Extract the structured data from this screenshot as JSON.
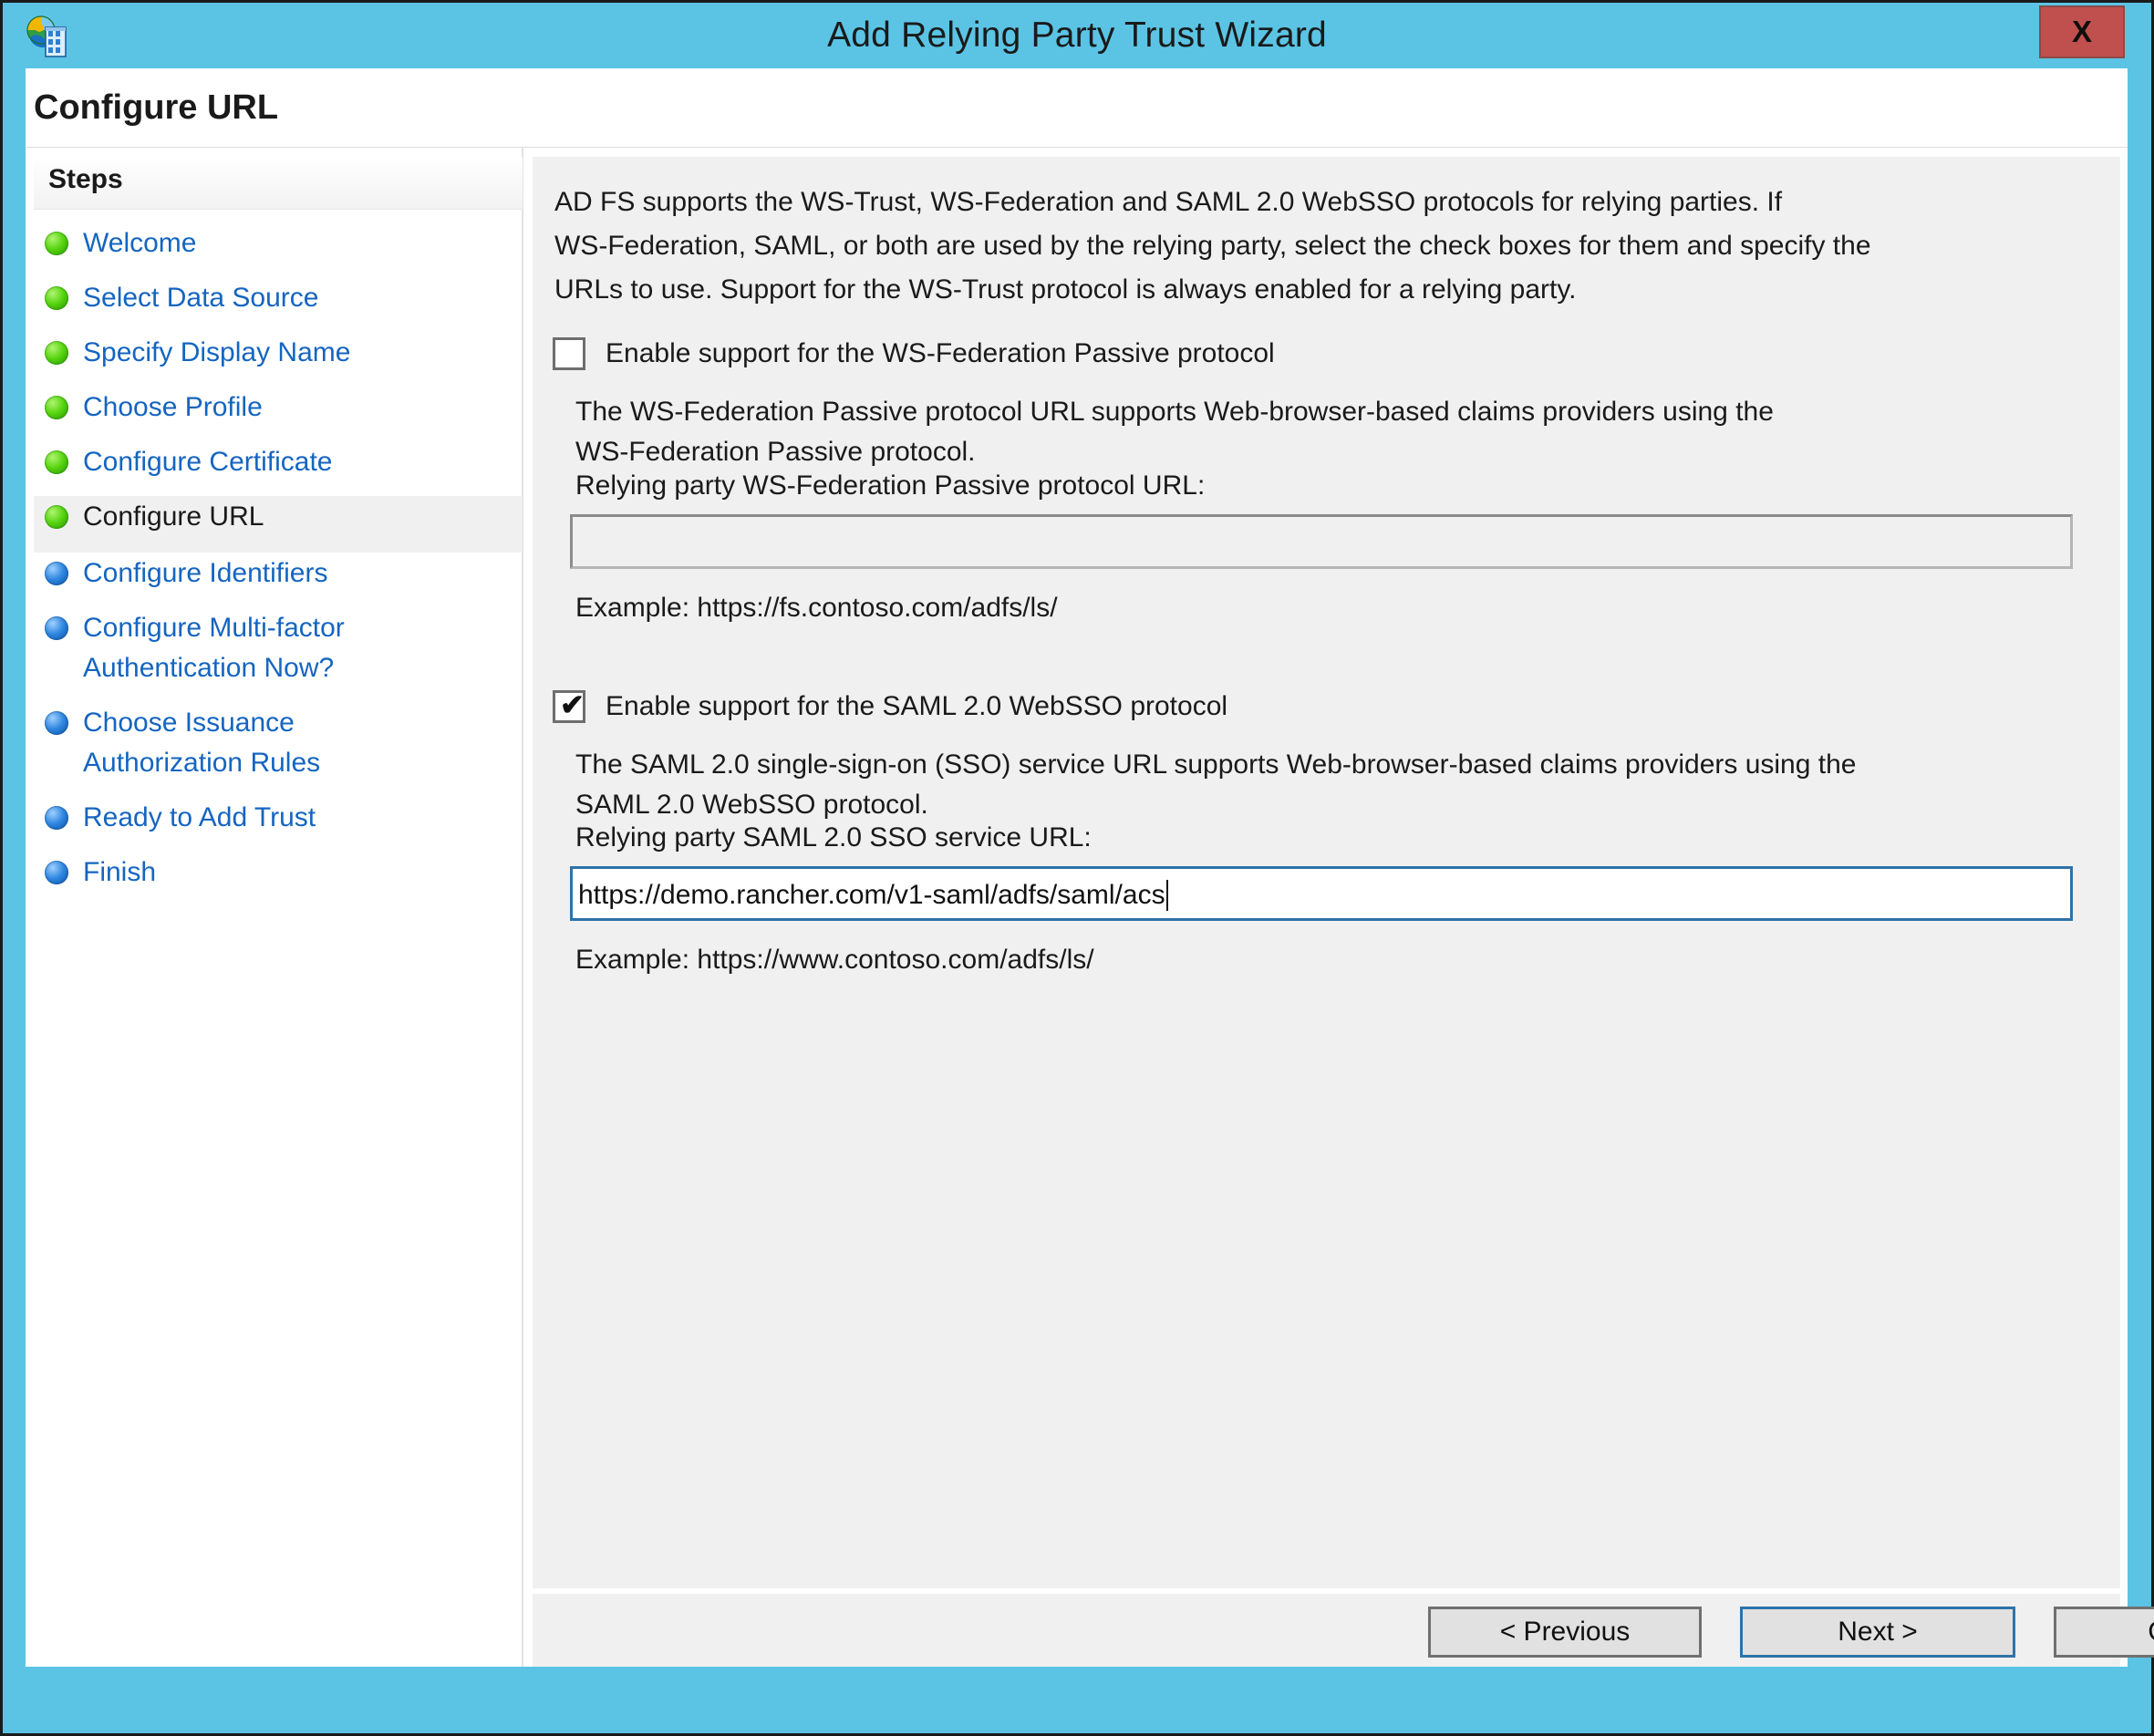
{
  "window": {
    "title": "Add Relying Party Trust Wizard",
    "close_label": "X",
    "icon": "relying-party-trust-icon",
    "titlebar_color": "#5BC4E4",
    "close_color": "#C0504D"
  },
  "page": {
    "heading": "Configure URL"
  },
  "sidebar": {
    "header": "Steps",
    "items": [
      {
        "label": "Welcome",
        "state": "done",
        "current": false
      },
      {
        "label": "Select Data Source",
        "state": "done",
        "current": false
      },
      {
        "label": "Specify Display Name",
        "state": "done",
        "current": false
      },
      {
        "label": "Choose Profile",
        "state": "done",
        "current": false
      },
      {
        "label": "Configure Certificate",
        "state": "done",
        "current": false
      },
      {
        "label": "Configure URL",
        "state": "done",
        "current": true
      },
      {
        "label": "Configure Identifiers",
        "state": "todo",
        "current": false
      },
      {
        "label": "Configure Multi-factor\nAuthentication Now?",
        "state": "todo",
        "current": false
      },
      {
        "label": "Choose Issuance\nAuthorization Rules",
        "state": "todo",
        "current": false
      },
      {
        "label": "Ready to Add Trust",
        "state": "todo",
        "current": false
      },
      {
        "label": "Finish",
        "state": "todo",
        "current": false
      }
    ],
    "link_color": "#1565C0",
    "done_color": "#55d40d",
    "todo_color": "#2e86e0"
  },
  "main": {
    "intro": "AD FS supports the WS-Trust, WS-Federation and SAML 2.0 WebSSO protocols for relying parties.  If\nWS-Federation, SAML, or both are used by the relying party, select the check boxes for them and specify the\nURLs to use.  Support for the WS-Trust protocol is always enabled for a relying party.",
    "wsfed": {
      "checkbox_label": "Enable support for the WS-Federation Passive protocol",
      "checked": false,
      "description": "The WS-Federation Passive protocol URL supports Web-browser-based claims providers using the\nWS-Federation Passive protocol.",
      "field_label": "Relying party WS-Federation Passive protocol URL:",
      "field_value": "",
      "example": "Example: https://fs.contoso.com/adfs/ls/"
    },
    "saml": {
      "checkbox_label": "Enable support for the SAML 2.0 WebSSO protocol",
      "checked": true,
      "check_glyph": "✔",
      "description": "The SAML 2.0 single-sign-on (SSO) service URL supports Web-browser-based claims providers using the\nSAML 2.0 WebSSO protocol.",
      "field_label": "Relying party SAML 2.0 SSO service URL:",
      "field_value": "https://demo.rancher.com/v1-saml/adfs/saml/acs",
      "example": "Example: https://www.contoso.com/adfs/ls/"
    }
  },
  "buttons": {
    "previous": "< Previous",
    "next": "Next >",
    "cancel": "Cancel",
    "default_focus": "next",
    "accent_color": "#2E72A8"
  }
}
